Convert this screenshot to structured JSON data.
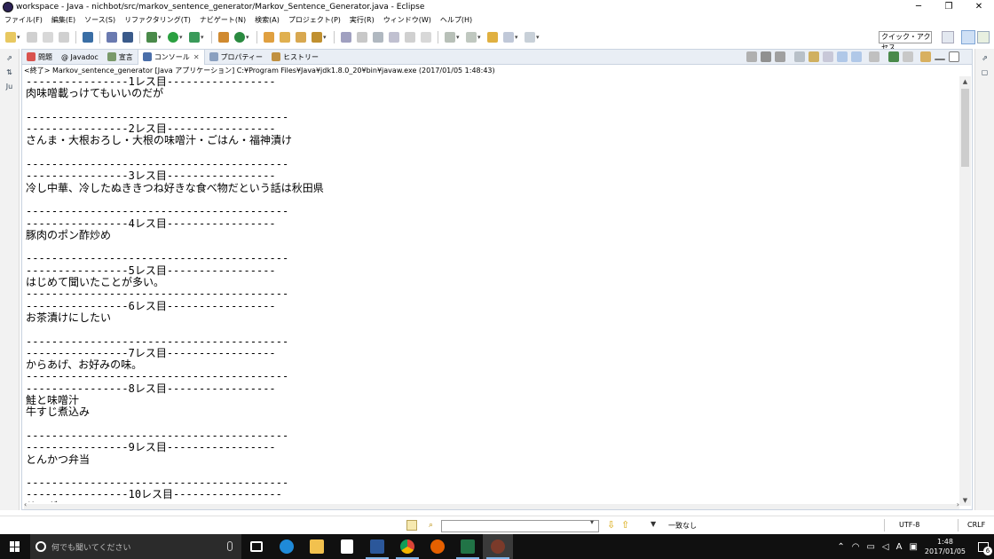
{
  "window": {
    "title": "workspace - Java - nichbot/src/markov_sentence_generator/Markov_Sentence_Generator.java - Eclipse",
    "minimize": "─",
    "maximize": "❐",
    "close": "✕"
  },
  "menu": [
    "ファイル(F)",
    "編集(E)",
    "ソース(S)",
    "リファクタリング(T)",
    "ナビゲート(N)",
    "検索(A)",
    "プロジェクト(P)",
    "実行(R)",
    "ウィンドウ(W)",
    "ヘルプ(H)"
  ],
  "toolbar": {
    "quick_access": "クイック・アクセス"
  },
  "left_trim": {
    "icons": [
      "⇗",
      "⇅",
      "Ju"
    ]
  },
  "right_trim": {
    "icons": [
      "⇗",
      "▢"
    ]
  },
  "tabs": [
    {
      "label": "問題",
      "icon": "problems-icon",
      "color": "#d9534f"
    },
    {
      "label": "@ Javadoc",
      "icon": "javadoc-icon",
      "color": "#6a8fbf"
    },
    {
      "label": "宣言",
      "icon": "declaration-icon",
      "color": "#7a9a6a"
    },
    {
      "label": "コンソール",
      "icon": "console-icon",
      "color": "#4a6ea9",
      "close": "✕"
    },
    {
      "label": "プロパティー",
      "icon": "properties-icon",
      "color": "#8aa0c0"
    },
    {
      "label": "ヒストリー",
      "icon": "history-icon",
      "color": "#c09040"
    }
  ],
  "console": {
    "status": "<終了> Markov_sentence_generator [Java アプリケーション] C:¥Program Files¥Java¥jdk1.8.0_20¥bin¥javaw.exe (2017/01/05 1:48:43)",
    "lines": [
      "----------------1レス目-----------------",
      "肉味噌載っけてもいいのだが",
      "",
      "-----------------------------------------",
      "----------------2レス目-----------------",
      "さんま・大根おろし・大根の味噌汁・ごはん・福神漬け",
      "",
      "-----------------------------------------",
      "----------------3レス目-----------------",
      "冷し中華、冷したぬききつね好きな食べ物だという話は秋田県",
      "",
      "-----------------------------------------",
      "----------------4レス目-----------------",
      "豚肉のポン酢炒め",
      "",
      "-----------------------------------------",
      "----------------5レス目-----------------",
      "はじめて聞いたことが多い。",
      "-----------------------------------------",
      "----------------6レス目-----------------",
      "お茶漬けにしたい",
      "",
      "-----------------------------------------",
      "----------------7レス目-----------------",
      "からあげ、お好みの味。",
      "-----------------------------------------",
      "----------------8レス目-----------------",
      "鮭と味噌汁",
      "牛すじ煮込み",
      "",
      "-----------------------------------------",
      "----------------9レス目-----------------",
      "とんかつ弁当",
      "",
      "-----------------------------------------",
      "----------------10レス目-----------------",
      "サラダ"
    ]
  },
  "statusbar": {
    "match": "一致なし",
    "encoding": "UTF-8",
    "eol": "CRLF"
  },
  "taskbar": {
    "search_placeholder": "何でも聞いてください",
    "apps": [
      {
        "name": "task-view",
        "color": "#ffffff"
      },
      {
        "name": "edge",
        "color": "#1f8ad8"
      },
      {
        "name": "file-explorer",
        "color": "#f2c14e"
      },
      {
        "name": "store",
        "color": "#ffffff"
      },
      {
        "name": "word",
        "color": "#2b579a"
      },
      {
        "name": "chrome",
        "color": "#e9b12d"
      },
      {
        "name": "firefox",
        "color": "#e66000"
      },
      {
        "name": "excel",
        "color": "#217346"
      },
      {
        "name": "eclipse",
        "color": "#7a3a2a"
      }
    ],
    "tray_ime": "A",
    "clock_time": "1:48",
    "clock_date": "2017/01/05",
    "notifications": "6"
  }
}
